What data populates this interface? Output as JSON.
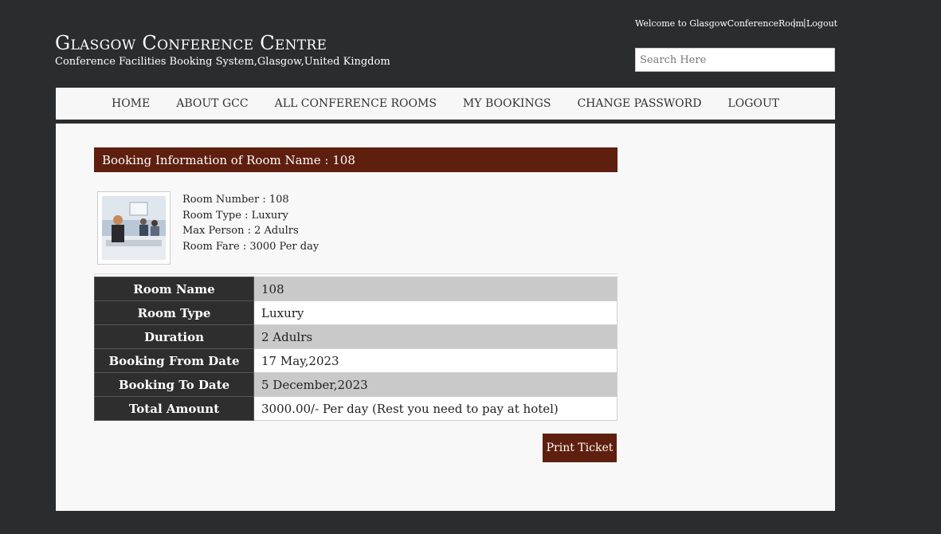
{
  "header": {
    "title": "Glasgow Conference Centre",
    "subtitle": "Conference Facilities Booking System,Glasgow,United Kingdom",
    "welcome": "Welcome to GlasgowConferenceRoom",
    "logout_label": "Logout",
    "search_placeholder": "Search Here"
  },
  "nav": {
    "items": [
      "HOME",
      "ABOUT GCC",
      "ALL CONFERENCE ROOMS",
      "MY BOOKINGS",
      "CHANGE PASSWORD",
      "LOGOUT"
    ]
  },
  "booking": {
    "header": "Booking Information of Room Name : 108",
    "room_info": {
      "number": "Room Number : 108",
      "type": "Room Type : Luxury",
      "max_person": "Max Person : 2 Adulrs",
      "fare": "Room Fare : 3000 Per day"
    },
    "rows": [
      {
        "label": "Room Name",
        "value": "108"
      },
      {
        "label": "Room Type",
        "value": "Luxury"
      },
      {
        "label": "Duration",
        "value": "2 Adulrs"
      },
      {
        "label": "Booking From Date",
        "value": "17 May,2023"
      },
      {
        "label": "Booking To Date",
        "value": "5 December,2023"
      },
      {
        "label": "Total Amount",
        "value": "3000.00/- Per day (Rest you need to pay at hotel)"
      }
    ],
    "print_label": "Print Ticket"
  },
  "colors": {
    "background": "#2b2c2e",
    "accent": "#5e1f0e",
    "panel": "#f8f8f8"
  }
}
